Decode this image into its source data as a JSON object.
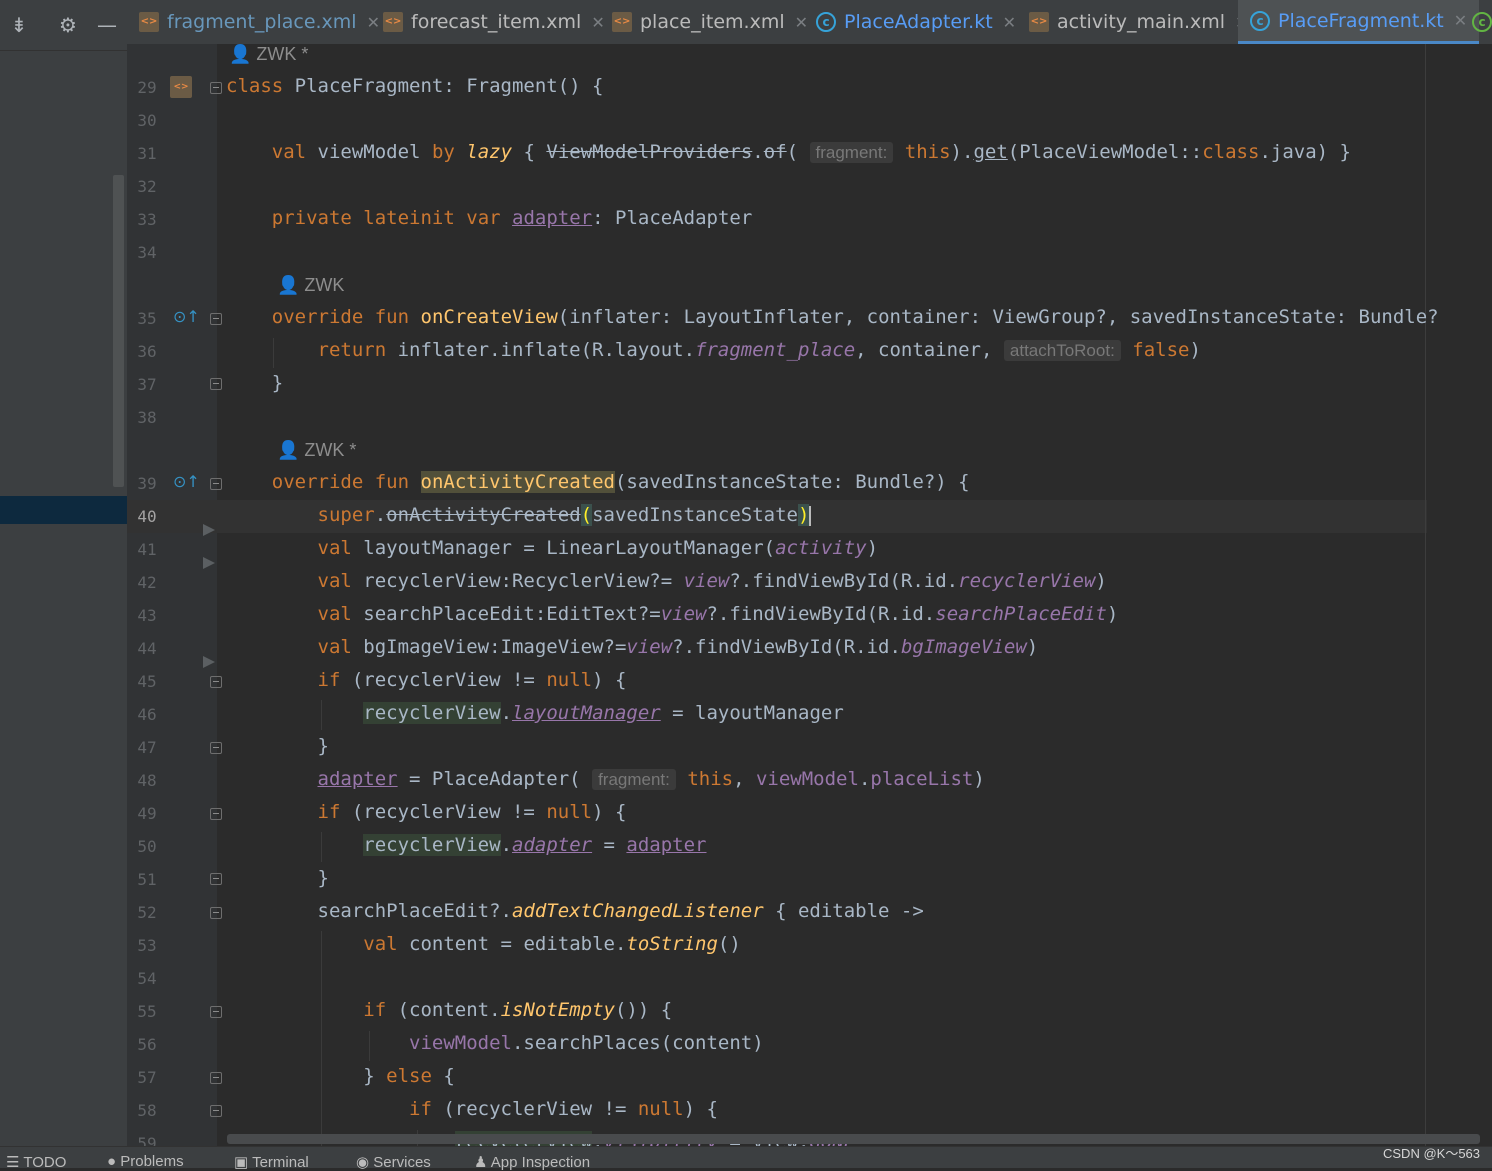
{
  "window": {
    "left_tools": [
      "collapse-all-icon",
      "settings-icon",
      "hide-icon"
    ],
    "tabs": [
      {
        "label": "fragment_place.xml",
        "icon": "xml-file-icon",
        "active": false
      },
      {
        "label": "forecast_item.xml",
        "icon": "xml-file-icon",
        "active": false
      },
      {
        "label": "place_item.xml",
        "icon": "xml-file-icon",
        "active": false
      },
      {
        "label": "PlaceAdapter.kt",
        "icon": "kotlin-class-icon",
        "active": false
      },
      {
        "label": "activity_main.xml",
        "icon": "xml-file-icon",
        "active": false
      },
      {
        "label": "PlaceFragment.kt",
        "icon": "kotlin-class-icon",
        "active": true
      }
    ]
  },
  "editor": {
    "current_line": "40",
    "authors": {
      "top": "ZWK *",
      "a35": "ZWK",
      "a39": "ZWK *"
    },
    "hints": {
      "fragment": "fragment:",
      "attachToRoot": "attachToRoot:"
    },
    "lines": [
      {
        "n": "29",
        "code": "class PlaceFragment: Fragment() {"
      },
      {
        "n": "30",
        "code": ""
      },
      {
        "n": "31",
        "code": "    val viewModel by lazy { ViewModelProviders.of( fragment: this).get(PlaceViewModel::class.java) }"
      },
      {
        "n": "32",
        "code": ""
      },
      {
        "n": "33",
        "code": "    private lateinit var adapter: PlaceAdapter"
      },
      {
        "n": "34",
        "code": ""
      },
      {
        "n": "35",
        "code": "    override fun onCreateView(inflater: LayoutInflater, container: ViewGroup?, savedInstanceState: Bundle?"
      },
      {
        "n": "36",
        "code": "        return inflater.inflate(R.layout.fragment_place, container,  attachToRoot: false)"
      },
      {
        "n": "37",
        "code": "    }"
      },
      {
        "n": "38",
        "code": ""
      },
      {
        "n": "39",
        "code": "    override fun onActivityCreated(savedInstanceState: Bundle?) {"
      },
      {
        "n": "40",
        "code": "        super.onActivityCreated(savedInstanceState)"
      },
      {
        "n": "41",
        "code": "        val layoutManager = LinearLayoutManager(activity)"
      },
      {
        "n": "42",
        "code": "        val recyclerView:RecyclerView?= view?.findViewById(R.id.recyclerView)"
      },
      {
        "n": "43",
        "code": "        val searchPlaceEdit:EditText?=view?.findViewById(R.id.searchPlaceEdit)"
      },
      {
        "n": "44",
        "code": "        val bgImageView:ImageView?=view?.findViewById(R.id.bgImageView)"
      },
      {
        "n": "45",
        "code": "        if (recyclerView != null) {"
      },
      {
        "n": "46",
        "code": "            recyclerView.layoutManager = layoutManager"
      },
      {
        "n": "47",
        "code": "        }"
      },
      {
        "n": "48",
        "code": "        adapter = PlaceAdapter( fragment: this, viewModel.placeList)"
      },
      {
        "n": "49",
        "code": "        if (recyclerView != null) {"
      },
      {
        "n": "50",
        "code": "            recyclerView.adapter = adapter"
      },
      {
        "n": "51",
        "code": "        }"
      },
      {
        "n": "52",
        "code": "        searchPlaceEdit?.addTextChangedListener { editable ->"
      },
      {
        "n": "53",
        "code": "            val content = editable.toString()"
      },
      {
        "n": "54",
        "code": ""
      },
      {
        "n": "55",
        "code": "            if (content.isNotEmpty()) {"
      },
      {
        "n": "56",
        "code": "                viewModel.searchPlaces(content)"
      },
      {
        "n": "57",
        "code": "            } else {"
      },
      {
        "n": "58",
        "code": "                if (recyclerView != null) {"
      },
      {
        "n": "59",
        "code": "                    recyclerView.visibility = View.GONE"
      }
    ]
  },
  "statusbar": {
    "items": [
      {
        "label": "TODO",
        "icon": "list-icon"
      },
      {
        "label": "Problems",
        "icon": "problems-icon"
      },
      {
        "label": "Terminal",
        "icon": "terminal-icon"
      },
      {
        "label": "Services",
        "icon": "services-icon"
      },
      {
        "label": "App Inspection",
        "icon": "app-inspection-icon"
      }
    ]
  },
  "watermark": "CSDN @K～563",
  "colors": {
    "keyword": "#cc7832",
    "function": "#ffc66d",
    "property": "#9876aa",
    "text": "#a9b7c6",
    "active_tab_accent": "#4a88c7"
  }
}
